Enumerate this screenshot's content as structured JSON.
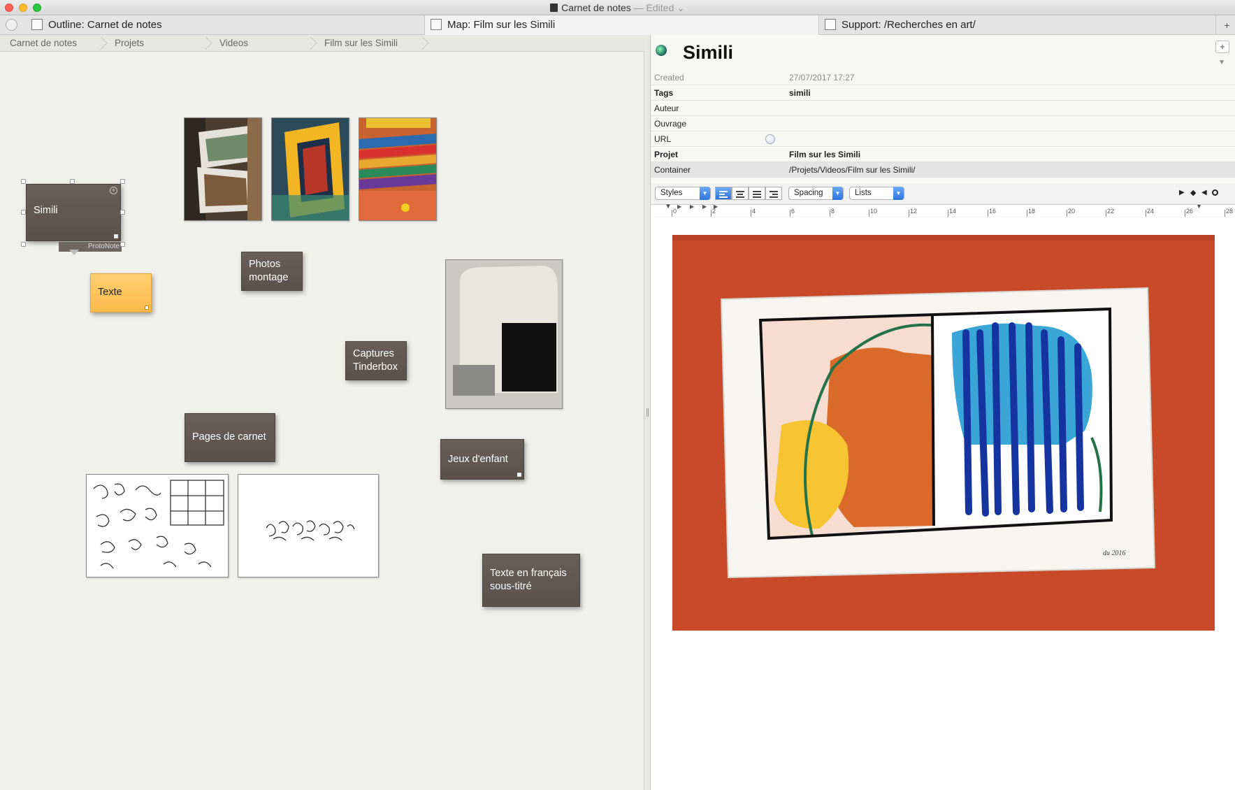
{
  "window": {
    "title": "Carnet de notes",
    "status": "— Edited",
    "chevron": "⌄"
  },
  "tabs": [
    {
      "label": "Outline: Carnet de notes",
      "icon": "outline-icon"
    },
    {
      "label": "Map: Film sur les Simili",
      "icon": "map-icon"
    },
    {
      "label": "Support: /Recherches en art/",
      "icon": "list-icon"
    }
  ],
  "tab_add": "+",
  "breadcrumb": [
    "Carnet de notes",
    "Projets",
    "Videos",
    "Film sur les Simili"
  ],
  "map": {
    "notes": {
      "simili": "Simili",
      "prototype_badge": "ProtoNote",
      "texte": "Texte",
      "photos_montage": "Photos montage",
      "captures_tinderbox": "Captures Tinderbox",
      "pages_de_carnet": "Pages de carnet",
      "jeux_d_enfant": "Jeux d'enfant",
      "texte_francais": "Texte en français sous-titré"
    }
  },
  "inspector": {
    "title": "Simili",
    "add_button": "+",
    "collapse_arrow": "▼",
    "attributes": [
      {
        "key": "Created",
        "value": "27/07/2017 17:27"
      },
      {
        "key": "Tags",
        "value": "simili"
      },
      {
        "key": "Auteur",
        "value": ""
      },
      {
        "key": "Ouvrage",
        "value": ""
      },
      {
        "key": "URL",
        "value": ""
      },
      {
        "key": "Projet",
        "value": "Film sur les Simili"
      },
      {
        "key": "Container",
        "value": "/Projets/Videos/Film sur les Simili/"
      }
    ],
    "toolbar": {
      "styles": "Styles",
      "spacing": "Spacing",
      "lists": "Lists"
    },
    "ruler_ticks": [
      "0",
      "2",
      "4",
      "6",
      "8",
      "10",
      "12",
      "14",
      "16",
      "18",
      "20",
      "22",
      "24",
      "26",
      "28"
    ],
    "painting_signature": "du 2016"
  },
  "colors": {
    "note_fill": "#5e544e",
    "texte_note": "#ffc65a",
    "picture_background": "#c84a28",
    "accent_blue": "#2d74e0"
  }
}
